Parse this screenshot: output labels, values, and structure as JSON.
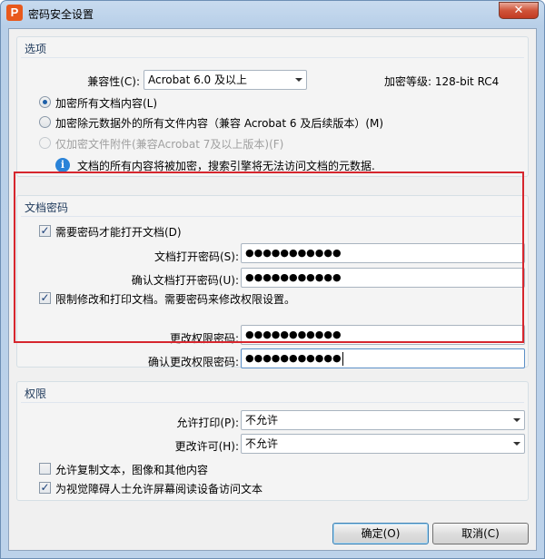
{
  "window": {
    "title": "密码安全设置",
    "app_icon": "P",
    "close_glyph": "✕"
  },
  "options": {
    "title": "选项",
    "compat_label": "兼容性(C):",
    "compat_value": "Acrobat 6.0 及以上",
    "encryption_level": "加密等级: 128-bit RC4",
    "radio_all": "加密所有文档内容(L)",
    "radio_except_meta": "加密除元数据外的所有文件内容（兼容 Acrobat 6 及后续版本）(M)",
    "radio_attachments": "仅加密文件附件(兼容Acrobat 7及以上版本)(F)",
    "info_text": "文档的所有内容将被加密，搜索引擎将无法访问文档的元数据."
  },
  "doc_password": {
    "title": "文档密码",
    "require_open": "需要密码才能打开文档(D)",
    "open_pwd_label": "文档打开密码(S):",
    "open_pwd_value": "●●●●●●●●●●●",
    "confirm_open_label": "确认文档打开密码(U):",
    "confirm_open_value": "●●●●●●●●●●●",
    "restrict": "限制修改和打印文档。需要密码来修改权限设置。",
    "perm_pwd_label": "更改权限密码:",
    "perm_pwd_value": "●●●●●●●●●●●",
    "confirm_perm_label": "确认更改权限密码:",
    "confirm_perm_value": "●●●●●●●●●●●"
  },
  "permissions": {
    "title": "权限",
    "print_label": "允许打印(P):",
    "print_value": "不允许",
    "change_label": "更改许可(H):",
    "change_value": "不允许",
    "copy_text": "允许复制文本，图像和其他内容",
    "screen_reader": "为视觉障碍人士允许屏幕阅读设备访问文本"
  },
  "buttons": {
    "ok": "确定(O)",
    "cancel": "取消(C)"
  },
  "colors": {
    "highlight": "#d6262e",
    "accent": "#2a83d8"
  }
}
